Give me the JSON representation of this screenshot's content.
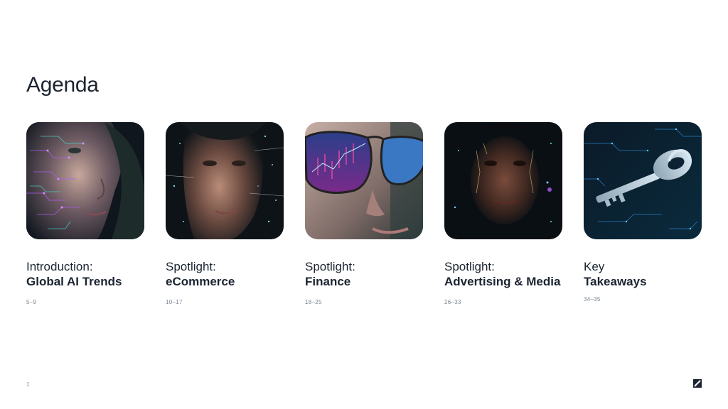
{
  "slide": {
    "title": "Agenda",
    "number": "1"
  },
  "items": [
    {
      "line1": "Introduction:",
      "line2": "Global AI Trends",
      "pages": "5–9",
      "image": "woman-with-purple-circuit-face"
    },
    {
      "line1": "Spotlight:",
      "line2": "eCommerce",
      "pages": "10–17",
      "image": "man-with-digital-particles-face"
    },
    {
      "line1": "Spotlight:",
      "line2": "Finance",
      "pages": "18–25",
      "image": "glasses-reflecting-stock-chart"
    },
    {
      "line1": "Spotlight:",
      "line2": "Advertising & Media",
      "pages": "26–33",
      "image": "woman-with-glowing-face-lines"
    },
    {
      "line1": "Key",
      "line2": "Takeaways",
      "pages": "34–35",
      "image": "digital-key-on-circuit-board"
    }
  ],
  "colors": {
    "text": "#1b2430",
    "muted": "#7a8593",
    "accent_purple": "#b35cff",
    "accent_teal": "#3ee6d2",
    "accent_blue": "#3aa0ff"
  }
}
